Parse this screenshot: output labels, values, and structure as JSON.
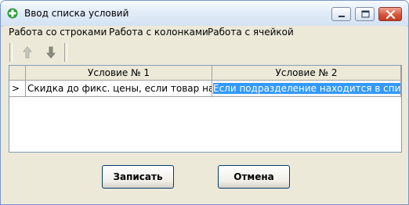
{
  "window": {
    "title": "Ввод списка условий"
  },
  "menu": {
    "items": [
      "Работа со строками",
      "Работа с колонками",
      "Работа с ячейкой"
    ]
  },
  "toolbar": {
    "buttons": [
      "move-up-icon",
      "move-down-icon"
    ]
  },
  "grid": {
    "columns": [
      "Условие № 1",
      "Условие № 2"
    ],
    "rows": [
      {
        "indicator": ">",
        "cells": [
          "Скидка до фикс. цены, если товар наход",
          "Если подразделение находится в списке"
        ]
      }
    ]
  },
  "buttons": {
    "save_label": "Записать",
    "cancel_label": "Отмена"
  },
  "colors": {
    "selection": "#3399ff",
    "window_bg": "#ece9d8",
    "close_button": "#d8543a"
  }
}
